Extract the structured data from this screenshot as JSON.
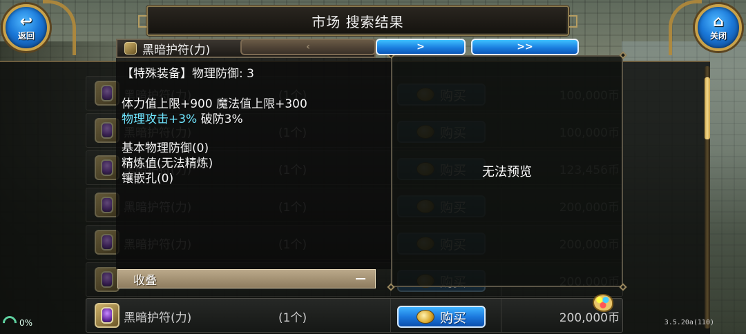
{
  "header": {
    "title": "市场  搜索结果",
    "back_label": "返回",
    "close_label": "关闭"
  },
  "pager": {
    "prev": "‹",
    "next": ">",
    "last": ">>"
  },
  "tooltip": {
    "item_name": "黑暗护符(力)",
    "lines": [
      "【特殊装备】物理防御: 3",
      "体力值上限+900 魔法值上限+300",
      "物理攻击+3%",
      "破防3%",
      "基本物理防御(0)",
      "精炼值(无法精炼)",
      "镶嵌孔(0)"
    ],
    "collapse_label": "收叠"
  },
  "preview": {
    "text": "无法预览"
  },
  "listings": [
    {
      "name": "黑暗护符(力)",
      "qty": "(1个)",
      "buy": "购买",
      "price": "100,000币"
    },
    {
      "name": "黑暗护符(力)",
      "qty": "(1个)",
      "buy": "购买",
      "price": "100,000币"
    },
    {
      "name": "黑暗护符(力)",
      "qty": "(1个)",
      "buy": "购买",
      "price": "123,456币"
    },
    {
      "name": "黑暗护符(力)",
      "qty": "(1个)",
      "buy": "购买",
      "price": "200,000币"
    },
    {
      "name": "黑暗护符(力)",
      "qty": "(1个)",
      "buy": "购买",
      "price": "200,000币"
    },
    {
      "name": "黑暗护符(力)",
      "qty": "(1个)",
      "buy": "购买",
      "price": "200,000币"
    },
    {
      "name": "黑暗护符(力)",
      "qty": "(1个)",
      "buy": "购买",
      "price": "200,000币"
    }
  ],
  "status": {
    "signal_percent": "0%",
    "version": "3.5.20a(110)"
  },
  "colors": {
    "button_blue": "#1c79de",
    "gold_frame": "#c9a24a",
    "tooltip_cyan": "#6fe6ff"
  }
}
